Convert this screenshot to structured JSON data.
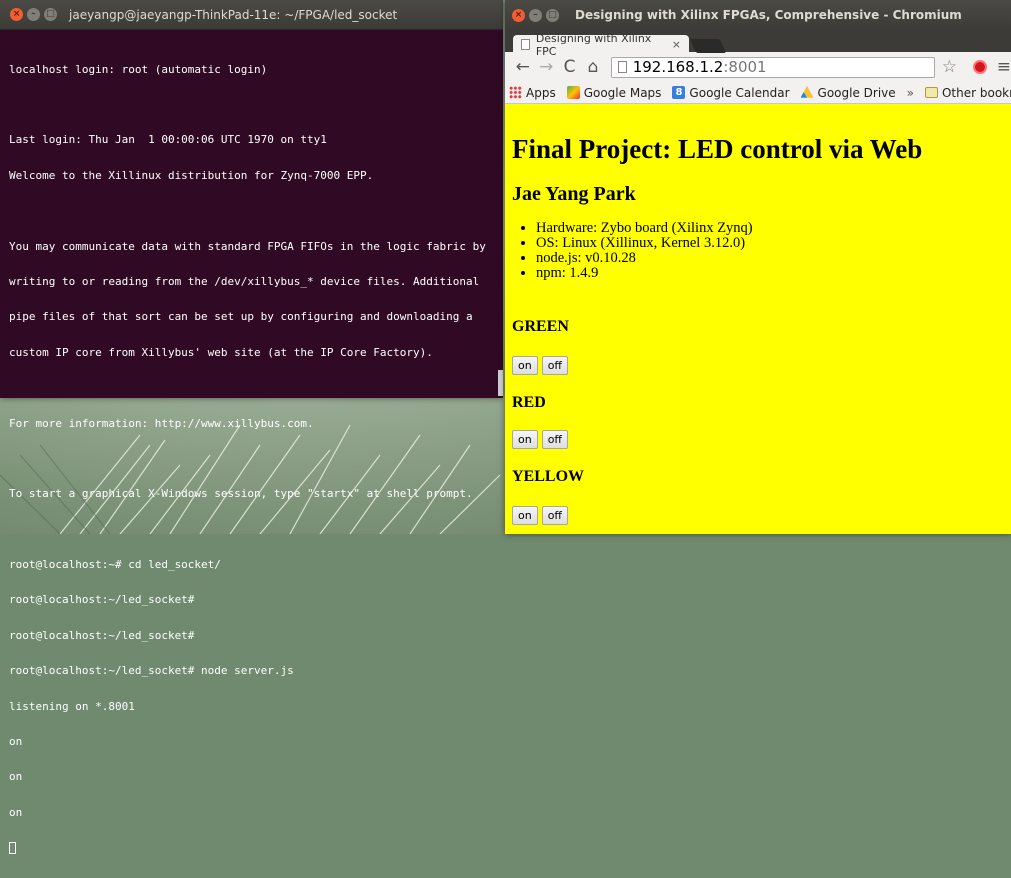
{
  "terminal": {
    "title": "jaeyangp@jaeyangp-ThinkPad-11e: ~/FPGA/led_socket",
    "lines": [
      "localhost login: root (automatic login)",
      "",
      "Last login: Thu Jan  1 00:00:06 UTC 1970 on tty1",
      "Welcome to the Xillinux distribution for Zynq-7000 EPP.",
      "",
      "You may communicate data with standard FPGA FIFOs in the logic fabric by",
      "writing to or reading from the /dev/xillybus_* device files. Additional",
      "pipe files of that sort can be set up by configuring and downloading a",
      "custom IP core from Xillybus' web site (at the IP Core Factory).",
      "",
      "For more information: http://www.xillybus.com.",
      "",
      "To start a graphical X-Windows session, type \"startx\" at shell prompt.",
      "",
      "root@localhost:~# cd led_socket/",
      "root@localhost:~/led_socket#",
      "root@localhost:~/led_socket#",
      "root@localhost:~/led_socket# node server.js",
      "listening on *.8001",
      "on",
      "on",
      "on"
    ]
  },
  "browser": {
    "window_title": "Designing with Xilinx FPGAs, Comprehensive - Chromium",
    "tab_label": "Designing with Xilinx FPC",
    "url_host": "192.168.1.2",
    "url_port": ":8001",
    "bookmarks": [
      "Apps",
      "Google Maps",
      "Google Calendar",
      "Google Drive",
      "Other bookmarks"
    ],
    "chevron": "»"
  },
  "page": {
    "title": "Final Project: LED control via Web",
    "author": "Jae Yang Park",
    "specs": [
      "Hardware: Zybo board (Xilinx Zynq)",
      "OS: Linux (Xillinux, Kernel 3.12.0)",
      "node.js: v0.10.28",
      "npm: 1.4.9"
    ],
    "sections": [
      {
        "label": "GREEN",
        "on": "on",
        "off": "off"
      },
      {
        "label": "RED",
        "on": "on",
        "off": "off"
      },
      {
        "label": "YELLOW",
        "on": "on",
        "off": "off"
      }
    ]
  },
  "colors": {
    "terminal_bg": "#300a24",
    "page_bg": "#ffff00",
    "titlebar": "#3c3b37"
  }
}
